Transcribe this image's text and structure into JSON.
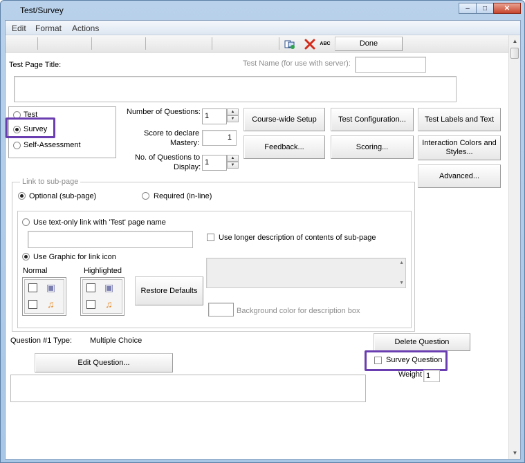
{
  "window": {
    "title": "Test/Survey",
    "minimize": "‒",
    "maximize": "□",
    "close": "✕"
  },
  "menu": [
    "Edit",
    "Format",
    "Actions"
  ],
  "toolbar": {
    "icons": [
      "page-link-icon",
      "delete-x-icon",
      "spellcheck-icon"
    ],
    "spell_text": "ABC",
    "done_label": "Done"
  },
  "page_title": {
    "label": "Test Page Title:",
    "test_name_label": "Test Name (for use with server):",
    "test_name_value": "",
    "title_value": ""
  },
  "type_options": {
    "test": "Test",
    "survey": "Survey",
    "self_assessment": "Self-Assessment",
    "selected": "Survey"
  },
  "fields": {
    "num_questions_label": "Number of Questions:",
    "num_questions_value": "1",
    "score_label_1": "Score to declare",
    "score_label_2": "Mastery:",
    "score_value": "1",
    "display_label_1": "No. of Questions to",
    "display_label_2": "Display:",
    "display_value": "1"
  },
  "buttons": {
    "course_setup": "Course-wide Setup",
    "test_config": "Test Configuration...",
    "test_labels": "Test Labels and Text",
    "feedback": "Feedback...",
    "scoring": "Scoring...",
    "interaction_colors": "Interaction Colors and Styles...",
    "advanced": "Advanced...",
    "restore_defaults": "Restore Defaults",
    "delete_question": "Delete Question",
    "edit_question": "Edit Question..."
  },
  "subpage": {
    "group_label": "Link to sub-page",
    "optional": "Optional (sub-page)",
    "required": "Required (in-line)",
    "selected": "Optional (sub-page)",
    "text_only": "Use text-only link with 'Test' page name",
    "text_only_value": "",
    "longer_desc": "Use longer description of contents of sub-page",
    "use_graphic": "Use Graphic for link icon",
    "normal_label": "Normal",
    "highlighted_label": "Highlighted",
    "bg_color_label": "Background color for description box"
  },
  "question": {
    "type_label": "Question #1 Type:",
    "type_value": "Multiple Choice",
    "survey_question": "Survey Question",
    "survey_checked": false,
    "weight_label": "Weight",
    "weight_value": "1"
  },
  "colors": {
    "highlight": "#6a3eb0",
    "delete_icon": "#d42a1a"
  }
}
